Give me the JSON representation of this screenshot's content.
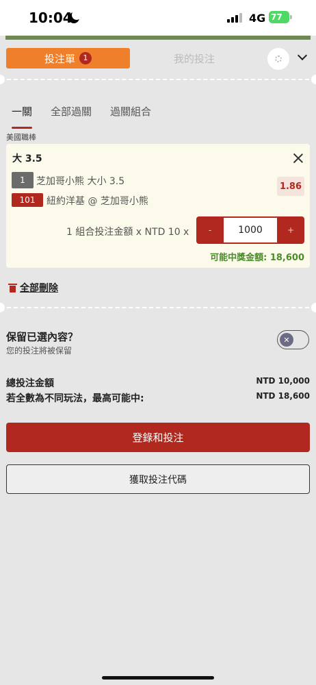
{
  "status_bar": {
    "time": "10:04",
    "network": "4G",
    "battery": "77"
  },
  "tabs": {
    "betslip_label": "投注單",
    "betslip_count": "1",
    "my_bets_label": "我的投注"
  },
  "bet_type_tabs": [
    "一關",
    "全部過關",
    "過關組合"
  ],
  "league": "美國職棒",
  "selection": {
    "title": "大 3.5",
    "market_code": "1",
    "market": "芝加哥小熊 大小 3.5",
    "match_code": "101",
    "match": "紐約洋基 @ 芝加哥小熊",
    "odds": "1.86",
    "stake_label": "1 組合投注金額 x NTD 10 x",
    "stake_value": "1000",
    "minus": "-",
    "plus": "+",
    "payout": "可能中獎金額: 18,600"
  },
  "delete_all": "全部刪除",
  "retain": {
    "title": "保留已選內容？",
    "subtitle": "您的投注將被保留",
    "toggle_symbol": "✕"
  },
  "summary": {
    "total_label": "總投注金額",
    "total_value": "NTD 10,000",
    "max_label": "若全數為不同玩法，最高可能中:",
    "max_value": "NTD 18,600"
  },
  "buttons": {
    "login_bet": "登錄和投注",
    "get_code": "獲取投注代碼"
  },
  "colors": {
    "accent_red": "#b0281e",
    "tab_orange": "#f07f2c",
    "payout_green": "#4a8c2a",
    "card_bg": "#fcfaea"
  }
}
